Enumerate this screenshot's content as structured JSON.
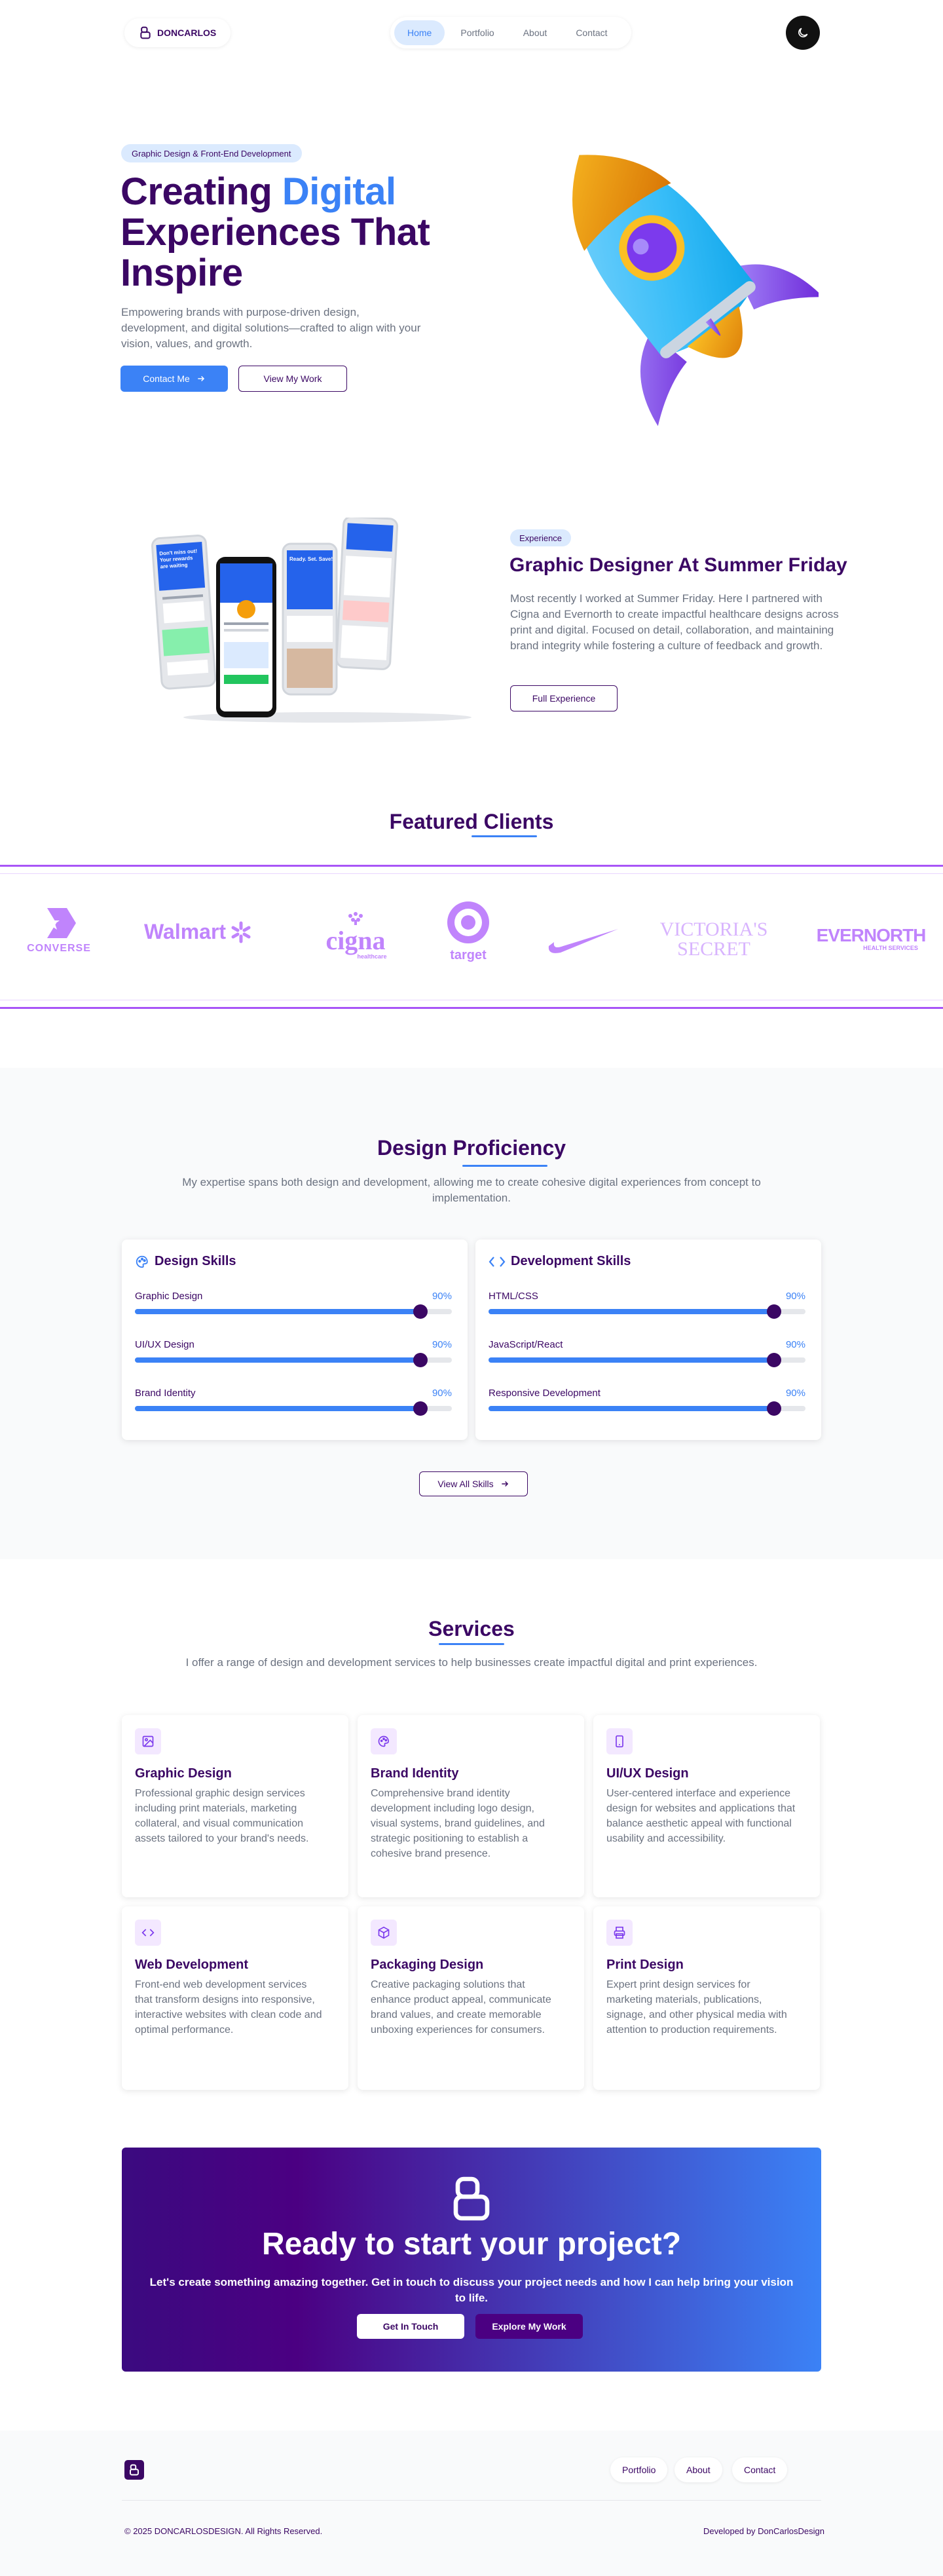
{
  "nav": {
    "brand": "DONCARLOS",
    "links": [
      {
        "label": "Home",
        "active": true
      },
      {
        "label": "Portfolio",
        "active": false
      },
      {
        "label": "About",
        "active": false
      },
      {
        "label": "Contact",
        "active": false
      }
    ],
    "theme_icon": "moon-icon"
  },
  "hero": {
    "badge": "Graphic Design & Front-End Development",
    "title_part1": "Creating ",
    "title_accent": "Digital",
    "title_part2": "Experiences That Inspire",
    "subtitle": "Empowering brands with purpose-driven design, development, and digital solutions—crafted to align with your vision, values, and growth.",
    "primary_button": "Contact Me",
    "secondary_button": "View My Work",
    "illustration": "rocket-illustration"
  },
  "experience": {
    "badge": "Experience",
    "title": "Graphic Designer At Summer Friday",
    "text": "Most recently I worked at Summer Friday. Here I partnered with Cigna and Evernorth to create impactful healthcare designs across print and digital. Focused on detail, collaboration, and maintaining brand integrity while fostering a culture of feedback and growth.",
    "button": "Full Experience",
    "phone_texts": {
      "p1_title": "Don't miss out! Your rewards are waiting",
      "p3_title": "Ready. Set. Save!"
    }
  },
  "clients": {
    "title": "Featured Clients",
    "logos": [
      {
        "name": "converse",
        "text": "CONVERSE"
      },
      {
        "name": "walmart",
        "text": "Walmart"
      },
      {
        "name": "cigna",
        "text": "cigna",
        "sub": "healthcare"
      },
      {
        "name": "target",
        "text": "target"
      },
      {
        "name": "nike",
        "text": ""
      },
      {
        "name": "victorias-secret",
        "text": "VICTORIA'S",
        "text2": "SECRET"
      },
      {
        "name": "evernorth",
        "text": "EVERNORTH",
        "sub": "HEALTH SERVICES"
      }
    ]
  },
  "proficiency": {
    "title": "Design Proficiency",
    "subtitle": "My expertise spans both design and development, allowing me to create cohesive digital experiences from concept to implementation.",
    "design": {
      "title": "Design Skills",
      "skills": [
        {
          "label": "Graphic Design",
          "percent_text": "90%",
          "value": 0.9
        },
        {
          "label": "UI/UX Design",
          "percent_text": "90%",
          "value": 0.9
        },
        {
          "label": "Brand Identity",
          "percent_text": "90%",
          "value": 0.9
        }
      ]
    },
    "development": {
      "title": "Development Skills",
      "skills": [
        {
          "label": "HTML/CSS",
          "percent_text": "90%",
          "value": 0.9
        },
        {
          "label": "JavaScript/React",
          "percent_text": "90%",
          "value": 0.9
        },
        {
          "label": "Responsive Development",
          "percent_text": "90%",
          "value": 0.9
        }
      ]
    },
    "button": "View All Skills"
  },
  "services": {
    "title": "Services",
    "subtitle": "I offer a range of design and development services to help businesses create impactful digital and print experiences.",
    "items": [
      {
        "icon": "image-icon",
        "title": "Graphic Design",
        "desc": "Professional graphic design services including print materials, marketing collateral, and visual communication assets tailored to your brand's needs."
      },
      {
        "icon": "palette-icon",
        "title": "Brand Identity",
        "desc": "Comprehensive brand identity development including logo design, visual systems, brand guidelines, and strategic positioning to establish a cohesive brand presence."
      },
      {
        "icon": "smartphone-icon",
        "title": "UI/UX Design",
        "desc": "User-centered interface and experience design for websites and applications that balance aesthetic appeal with functional usability and accessibility."
      },
      {
        "icon": "code-icon",
        "title": "Web Development",
        "desc": "Front-end web development services that transform designs into responsive, interactive websites with clean code and optimal performance."
      },
      {
        "icon": "package-icon",
        "title": "Packaging Design",
        "desc": "Creative packaging solutions that enhance product appeal, communicate brand values, and create memorable unboxing experiences for consumers."
      },
      {
        "icon": "printer-icon",
        "title": "Print Design",
        "desc": "Expert print design services for marketing materials, publications, signage, and other physical media with attention to production requirements."
      }
    ]
  },
  "cta": {
    "title": "Ready to start your project?",
    "subtitle": "Let's create something amazing together. Get in touch to discuss your project needs and how I can help bring your vision to life.",
    "primary": "Get In Touch",
    "secondary": "Explore My Work"
  },
  "footer": {
    "links": [
      "Portfolio",
      "About",
      "Contact"
    ],
    "copyright": "© 2025 DONCARLOSDESIGN. All Rights Reserved.",
    "credit": "Developed by DonCarlosDesign"
  },
  "colors": {
    "primary_purple": "#3b0764",
    "accent_blue": "#3b82f6",
    "light_blue": "#dbeafe",
    "logo_purple": "#c084fc"
  }
}
